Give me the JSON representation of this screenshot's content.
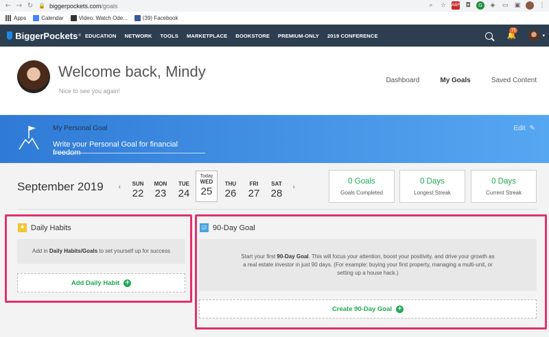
{
  "browser": {
    "url_host": "biggerpockets.com",
    "url_path": "/goals",
    "bookmarks": [
      "Apps",
      "Calendar",
      "Video: Watch Ode...",
      "(39) Facebook"
    ]
  },
  "site_nav": {
    "brand": "BiggerPockets",
    "links": [
      "EDUCATION",
      "NETWORK",
      "TOOLS",
      "MARKETPLACE",
      "BOOKSTORE",
      "PREMIUM-ONLY",
      "2019 CONFERENCE"
    ],
    "notification_count": "75"
  },
  "welcome": {
    "title": "Welcome back, Mindy",
    "subtitle": "Nice to see you again!",
    "tabs": [
      "Dashboard",
      "My Goals",
      "Saved Content"
    ]
  },
  "personal_goal": {
    "label": "My Personal Goal",
    "placeholder": "Write your Personal Goal for financial freedom",
    "edit_label": "Edit"
  },
  "calendar": {
    "month": "September 2019",
    "today_label": "Today",
    "days": [
      {
        "name": "SUN",
        "date": "22"
      },
      {
        "name": "MON",
        "date": "23"
      },
      {
        "name": "TUE",
        "date": "24"
      },
      {
        "name": "WED",
        "date": "25"
      },
      {
        "name": "THU",
        "date": "26"
      },
      {
        "name": "FRI",
        "date": "27"
      },
      {
        "name": "SAT",
        "date": "28"
      }
    ]
  },
  "stats": [
    {
      "value": "0 Goals",
      "label": "Goals Completed"
    },
    {
      "value": "0 Days",
      "label": "Longest Streak"
    },
    {
      "value": "0 Days",
      "label": "Current Streak"
    }
  ],
  "daily_habits": {
    "title": "Daily Habits",
    "message_pre": "Add in ",
    "message_bold": "Daily Habits/Goals",
    "message_post": " to set yourself up for success",
    "button": "Add Daily Habit"
  },
  "ninety_day": {
    "title": "90-Day Goal",
    "message_pre": "Start your first ",
    "message_bold": "90-Day Goal",
    "message_post": ". This will focus your attention, boost your positivity, and drive your growth as a real estate investor in just 90 days. (For example: buying your first property, managing a multi-unit, or setting up a house hack.)",
    "button": "Create 90-Day Goal"
  },
  "colors": {
    "nav_bg": "#2c3e50",
    "accent_green": "#1ea855",
    "highlight": "#e0306c",
    "banner": "#2f7ad6"
  }
}
